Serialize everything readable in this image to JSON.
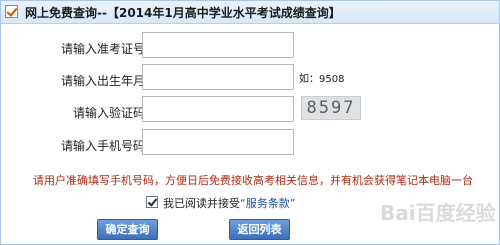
{
  "title": {
    "prefix": "网上免费查询--",
    "text": "【2014年1月高中学业水平考试成绩查询】"
  },
  "form": {
    "exam_number": {
      "label": "请输入准考证号：",
      "value": ""
    },
    "birth_month": {
      "label": "请输入出生年月：",
      "value": "",
      "hint": "如：9508"
    },
    "captcha_input": {
      "label": "请输入验证码：",
      "value": ""
    },
    "captcha_image_text": "8597",
    "phone": {
      "label": "请输入手机号码：",
      "value": ""
    }
  },
  "notice": "请用户准确填写手机号码，方便日后免费接收高考相关信息，并有机会获得笔记本电脑一台",
  "agree": {
    "checked": true,
    "text": "我已阅读并接受",
    "terms_link": "“服务条款”"
  },
  "buttons": {
    "query": "确定查询",
    "back": "返回列表"
  },
  "watermark": "Bai百度经验"
}
